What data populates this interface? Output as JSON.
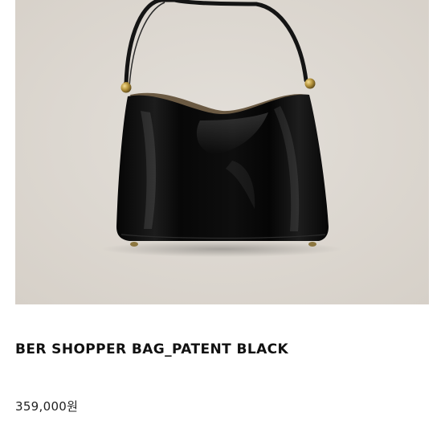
{
  "product": {
    "image_alt_icon": "handbag-photo",
    "name": "BER SHOPPER BAG_PATENT BLACK",
    "price": "359,000원"
  },
  "colors": {
    "photo_background": "#ddd8d1",
    "bag_body": "#0b0b0b",
    "hardware": "#a8893f",
    "text": "#111111"
  }
}
